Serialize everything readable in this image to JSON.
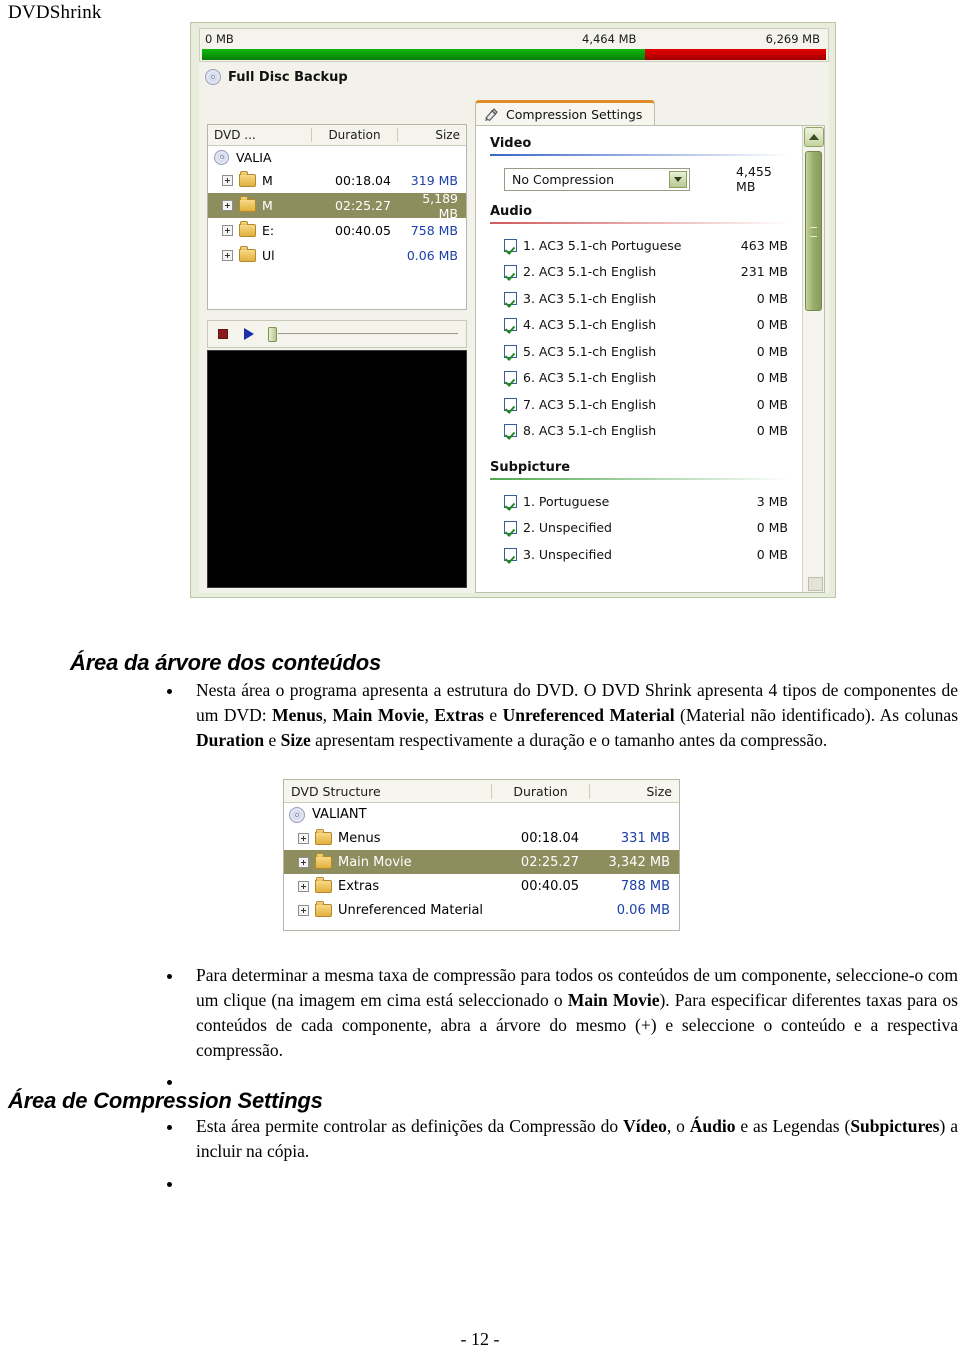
{
  "document": {
    "header": "DVDShrink",
    "footer": "- 12 -"
  },
  "screenshot_main": {
    "size_bar": {
      "left_label": "0 MB",
      "mid_label": "4,464 MB",
      "right_label": "6,269 MB",
      "green_percent": 71,
      "green_color": "#0ba00b",
      "red_color": "#cc0000"
    },
    "title": "Full Disc Backup",
    "title_icon": "disc-icon",
    "tree": {
      "columns": {
        "name": "DVD ...",
        "duration": "Duration",
        "size": "Size"
      },
      "root": "VALIA",
      "rows": [
        {
          "name": "M",
          "duration": "00:18.04",
          "size": "319 MB",
          "selected": false
        },
        {
          "name": "M",
          "duration": "02:25.27",
          "size": "5,189 MB",
          "selected": true
        },
        {
          "name": "E:",
          "duration": "00:40.05",
          "size": "758 MB",
          "selected": false
        },
        {
          "name": "Ul",
          "duration": "",
          "size": "0.06 MB",
          "selected": false
        }
      ],
      "selection_color": "#8d8d5e"
    },
    "preview_controls": {
      "stop_icon": "stop-icon",
      "play_icon": "play-icon",
      "seek_position_percent": 0
    },
    "tab": {
      "label": "Compression Settings",
      "icon": "compression-icon",
      "accent_color": "#e08c28"
    },
    "video": {
      "section_title": "Video",
      "compression_value": "No Compression",
      "compression_options": [
        "No Compression"
      ],
      "size": "4,455 MB"
    },
    "audio": {
      "section_title": "Audio",
      "tracks": [
        {
          "checked": true,
          "label": "1. AC3 5.1-ch Portuguese",
          "size": "463 MB"
        },
        {
          "checked": true,
          "label": "2. AC3 5.1-ch English",
          "size": "231 MB"
        },
        {
          "checked": true,
          "label": "3. AC3 5.1-ch English",
          "size": "0 MB"
        },
        {
          "checked": true,
          "label": "4. AC3 5.1-ch English",
          "size": "0 MB"
        },
        {
          "checked": true,
          "label": "5. AC3 5.1-ch English",
          "size": "0 MB"
        },
        {
          "checked": true,
          "label": "6. AC3 5.1-ch English",
          "size": "0 MB"
        },
        {
          "checked": true,
          "label": "7. AC3 5.1-ch English",
          "size": "0 MB"
        },
        {
          "checked": true,
          "label": "8. AC3 5.1-ch English",
          "size": "0 MB"
        }
      ]
    },
    "subpicture": {
      "section_title": "Subpicture",
      "tracks": [
        {
          "checked": true,
          "label": "1. Portuguese",
          "size": "3 MB"
        },
        {
          "checked": true,
          "label": "2. Unspecified",
          "size": "0 MB"
        },
        {
          "checked": true,
          "label": "3. Unspecified",
          "size": "0 MB"
        }
      ]
    }
  },
  "body": {
    "heading_tree": "Área da árvore dos conteúdos",
    "para_tree_html": "Nesta área o programa apresenta a estrutura do DVD. O DVD Shrink apresenta 4 tipos de componentes de um DVD: <b>Menus</b>, <b>Main Movie</b>, <b>Extras</b> e <b>Unreferenced Material</b> (Material não identificado). As colunas <b>Duration</b> e <b>Size</b> apresentam respectivamente a duração e o tamanho antes da compressão.",
    "para_rate_html": "Para determinar a mesma taxa de compressão para todos os conteúdos de um componente, seleccione-o com um clique (na imagem em cima está seleccionado o <b>Main Movie</b>). Para especificar diferentes taxas para os conteúdos de cada componente, abra a árvore do mesmo (+) e seleccione o conteúdo e a respectiva compressão.",
    "heading_compression": "Área de Compression Settings",
    "para_compression_html": "Esta área permite controlar as definições da Compressão do <b>Vídeo</b>, o <b>Áudio</b> e as Legendas (<b>Subpictures</b>) a incluir na cópia."
  },
  "screenshot_structure": {
    "columns": {
      "name": "DVD Structure",
      "duration": "Duration",
      "size": "Size"
    },
    "root": "VALIANT",
    "rows": [
      {
        "name": "Menus",
        "duration": "00:18.04",
        "size": "331 MB",
        "selected": false
      },
      {
        "name": "Main Movie",
        "duration": "02:25.27",
        "size": "3,342 MB",
        "selected": true
      },
      {
        "name": "Extras",
        "duration": "00:40.05",
        "size": "788 MB",
        "selected": false
      },
      {
        "name": "Unreferenced Material",
        "duration": "",
        "size": "0.06 MB",
        "selected": false
      }
    ],
    "selection_color": "#8d8d5e"
  }
}
